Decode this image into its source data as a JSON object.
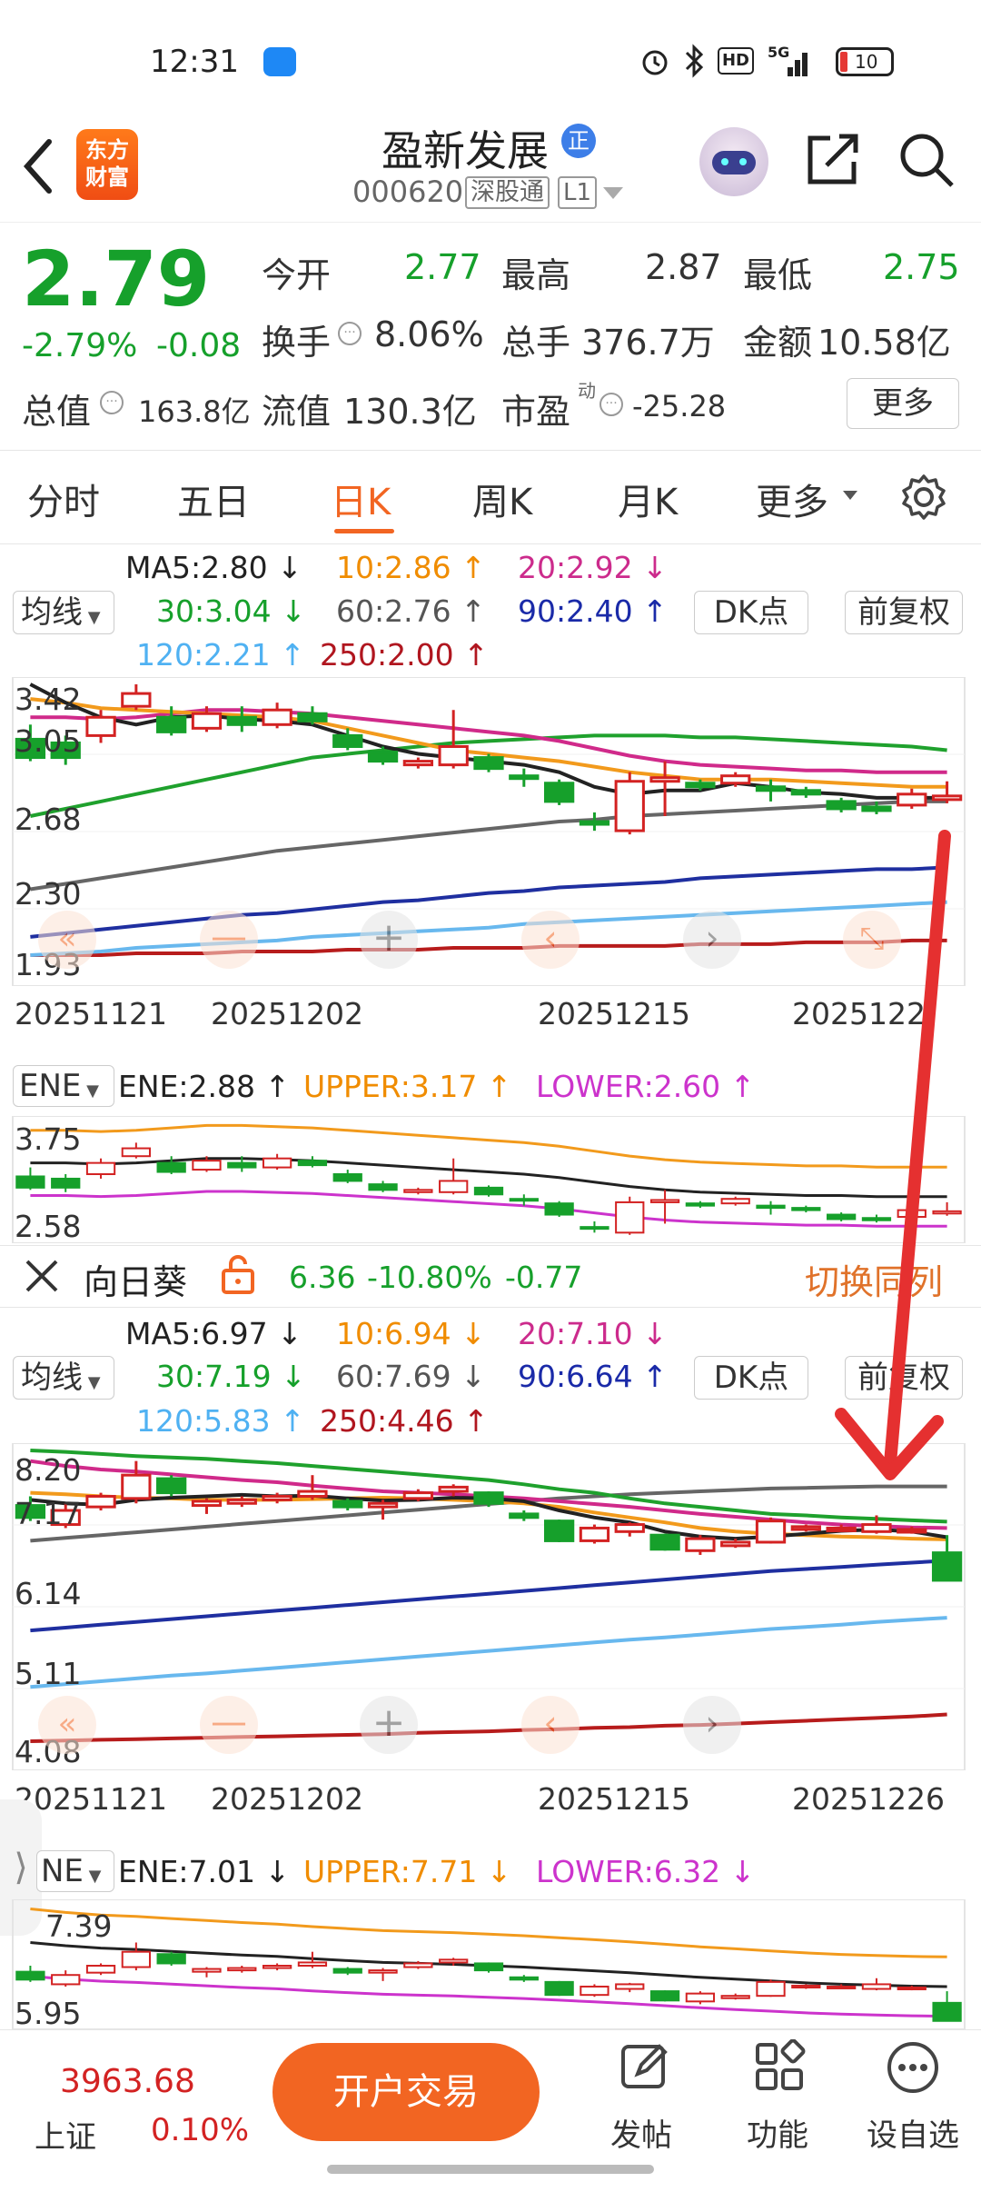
{
  "status_bar": {
    "time": "12:31",
    "battery": "10",
    "network": "5G"
  },
  "header": {
    "back_icon": "chevron-left-icon",
    "logo_text": "东方\n财富",
    "logo_line1": "东方",
    "logo_line2": "财富",
    "stock_name": "盈新发展",
    "badge": "正",
    "stock_code": "000620",
    "market_tag": "深股通",
    "level_tag": "L1"
  },
  "quote": {
    "price": "2.79",
    "change_pct": "-2.79%",
    "change": "-0.08",
    "open_label": "今开",
    "open": "2.77",
    "high_label": "最高",
    "high": "2.87",
    "low_label": "最低",
    "low": "2.75",
    "turnover_label": "换手",
    "turnover": "8.06%",
    "volume_label": "总手",
    "volume": "376.7万",
    "amount_label": "金额",
    "amount": "10.58亿",
    "mktcap_label": "总值",
    "mktcap": "163.8亿",
    "float_label": "流值",
    "float_cap": "130.3亿",
    "pe_label": "市盈",
    "pe_sup": "动",
    "pe": "-25.28",
    "more_label": "更多"
  },
  "tabs": [
    "分时",
    "五日",
    "日K",
    "周K",
    "月K",
    "更多"
  ],
  "active_tab": "日K",
  "chart1": {
    "indicator_select": "均线",
    "dk_label": "DK点",
    "adjust_label": "前复权",
    "ma": {
      "ma5": "MA5:2.80 ↓",
      "ma10": "10:2.86 ↑",
      "ma20": "20:2.92 ↓",
      "ma30": "30:3.04 ↓",
      "ma60": "60:2.76 ↑",
      "ma90": "90:2.40 ↑",
      "ma120": "120:2.21 ↑",
      "ma250": "250:2.00 ↑"
    },
    "y_ticks": [
      "3.42",
      "3.05",
      "2.68",
      "2.30",
      "1.93"
    ],
    "x_ticks": [
      "20251121",
      "20251202",
      "20251215",
      "2025122"
    ],
    "ene_select": "ENE",
    "ene": "ENE:2.88 ↑",
    "upper": "UPPER:3.17 ↑",
    "lower": "LOWER:2.60 ↑",
    "ene_ticks": [
      "3.75",
      "2.58"
    ]
  },
  "compare": {
    "close_icon": "close-icon",
    "name": "向日葵",
    "lock_icon": "lock-icon",
    "price": "6.36",
    "change_pct": "-10.80%",
    "change": "-0.77",
    "switch_label": "切换同列"
  },
  "chart2": {
    "indicator_select": "均线",
    "dk_label": "DK点",
    "adjust_label": "前复权",
    "ma": {
      "ma5": "MA5:6.97 ↓",
      "ma10": "10:6.94 ↓",
      "ma20": "20:7.10 ↓",
      "ma30": "30:7.19 ↓",
      "ma60": "60:7.69 ↓",
      "ma90": "90:6.64 ↑",
      "ma120": "120:5.83 ↑",
      "ma250": "250:4.46 ↑"
    },
    "y_ticks": [
      "8.20",
      "7.17",
      "6.14",
      "5.11",
      "4.08"
    ],
    "x_ticks": [
      "20251121",
      "20251202",
      "20251215",
      "20251226"
    ],
    "ene_select": "NE",
    "ene": "ENE:7.01 ↓",
    "upper": "UPPER:7.71 ↓",
    "lower": "LOWER:6.32 ↓",
    "ene_ticks": [
      "7.39",
      "5.95"
    ]
  },
  "bottom_bar": {
    "index_value": "3963.68",
    "index_name": "上证",
    "index_change": "0.10%",
    "trade_button": "开户交易",
    "post_label": "发帖",
    "func_label": "功能",
    "watch_label": "设自选"
  },
  "colors": {
    "up": "#d32222",
    "down": "#16a02b",
    "accent": "#f26522",
    "ma5": "#222222",
    "ma10": "#f29a1c",
    "ma20": "#d02a8a",
    "ma30": "#1fa12d",
    "ma60": "#666666",
    "ma90": "#1f2fa0",
    "ma120": "#68b8ee",
    "ma250": "#b71c1c"
  },
  "chart_data": [
    {
      "type": "candlestick",
      "name": "盈新发展 日K",
      "ylim": [
        1.93,
        3.42
      ],
      "x_ticks": [
        "20251121",
        "20251202",
        "20251215",
        "2025122"
      ],
      "candles": [
        {
          "o": 3.1,
          "c": 3.0,
          "h": 3.18,
          "l": 2.98
        },
        {
          "o": 3.08,
          "c": 3.0,
          "h": 3.12,
          "l": 2.96
        },
        {
          "o": 3.12,
          "c": 3.22,
          "h": 3.26,
          "l": 3.08
        },
        {
          "o": 3.28,
          "c": 3.35,
          "h": 3.4,
          "l": 3.26
        },
        {
          "o": 3.22,
          "c": 3.14,
          "h": 3.28,
          "l": 3.12
        },
        {
          "o": 3.16,
          "c": 3.24,
          "h": 3.28,
          "l": 3.14
        },
        {
          "o": 3.22,
          "c": 3.18,
          "h": 3.28,
          "l": 3.14
        },
        {
          "o": 3.18,
          "c": 3.26,
          "h": 3.3,
          "l": 3.16
        },
        {
          "o": 3.24,
          "c": 3.2,
          "h": 3.28,
          "l": 3.18
        },
        {
          "o": 3.12,
          "c": 3.06,
          "h": 3.16,
          "l": 3.04
        },
        {
          "o": 3.03,
          "c": 2.98,
          "h": 3.06,
          "l": 2.96
        },
        {
          "o": 2.96,
          "c": 2.98,
          "h": 3.0,
          "l": 2.94
        },
        {
          "o": 2.96,
          "c": 3.06,
          "h": 3.26,
          "l": 2.94
        },
        {
          "o": 3.0,
          "c": 2.94,
          "h": 3.02,
          "l": 2.92
        },
        {
          "o": 2.9,
          "c": 2.89,
          "h": 2.94,
          "l": 2.84
        },
        {
          "o": 2.86,
          "c": 2.76,
          "h": 2.88,
          "l": 2.74
        },
        {
          "o": 2.65,
          "c": 2.64,
          "h": 2.7,
          "l": 2.6
        },
        {
          "o": 2.6,
          "c": 2.87,
          "h": 2.92,
          "l": 2.58
        },
        {
          "o": 2.87,
          "c": 2.89,
          "h": 2.98,
          "l": 2.68
        },
        {
          "o": 2.86,
          "c": 2.84,
          "h": 2.88,
          "l": 2.82
        },
        {
          "o": 2.86,
          "c": 2.9,
          "h": 2.92,
          "l": 2.84
        },
        {
          "o": 2.84,
          "c": 2.82,
          "h": 2.88,
          "l": 2.76
        },
        {
          "o": 2.82,
          "c": 2.8,
          "h": 2.84,
          "l": 2.78
        },
        {
          "o": 2.76,
          "c": 2.72,
          "h": 2.78,
          "l": 2.7
        },
        {
          "o": 2.73,
          "c": 2.71,
          "h": 2.76,
          "l": 2.69
        },
        {
          "o": 2.74,
          "c": 2.8,
          "h": 2.83,
          "l": 2.72
        },
        {
          "o": 2.77,
          "c": 2.79,
          "h": 2.87,
          "l": 2.75
        }
      ],
      "series": [
        {
          "name": "MA5",
          "values": [
            3.4,
            3.3,
            3.22,
            3.18,
            3.22,
            3.23,
            3.21,
            3.2,
            3.18,
            3.12,
            3.06,
            3.02,
            3.0,
            2.98,
            2.96,
            2.92,
            2.84,
            2.8,
            2.82,
            2.82,
            2.86,
            2.84,
            2.81,
            2.8,
            2.78,
            2.78,
            2.78
          ]
        },
        {
          "name": "10",
          "values": [
            3.32,
            3.3,
            3.27,
            3.26,
            3.25,
            3.24,
            3.23,
            3.22,
            3.2,
            3.16,
            3.12,
            3.08,
            3.04,
            3.02,
            3.0,
            2.98,
            2.95,
            2.92,
            2.9,
            2.88,
            2.88,
            2.88,
            2.87,
            2.86,
            2.85,
            2.84,
            2.84
          ]
        },
        {
          "name": "20",
          "values": [
            3.22,
            3.22,
            3.21,
            3.22,
            3.24,
            3.26,
            3.26,
            3.25,
            3.24,
            3.22,
            3.2,
            3.18,
            3.16,
            3.14,
            3.12,
            3.09,
            3.05,
            3.01,
            2.98,
            2.96,
            2.95,
            2.94,
            2.93,
            2.93,
            2.92,
            2.92,
            2.92
          ]
        },
        {
          "name": "30",
          "values": [
            2.68,
            2.72,
            2.76,
            2.8,
            2.84,
            2.88,
            2.92,
            2.96,
            3.0,
            3.02,
            3.04,
            3.06,
            3.08,
            3.09,
            3.1,
            3.11,
            3.12,
            3.12,
            3.12,
            3.11,
            3.11,
            3.1,
            3.09,
            3.08,
            3.07,
            3.06,
            3.04
          ]
        },
        {
          "name": "60",
          "values": [
            2.28,
            2.31,
            2.34,
            2.37,
            2.4,
            2.43,
            2.46,
            2.49,
            2.51,
            2.53,
            2.55,
            2.57,
            2.59,
            2.61,
            2.63,
            2.65,
            2.66,
            2.68,
            2.69,
            2.7,
            2.71,
            2.72,
            2.73,
            2.74,
            2.75,
            2.76,
            2.76
          ]
        },
        {
          "name": "90",
          "values": [
            2.02,
            2.04,
            2.06,
            2.08,
            2.1,
            2.12,
            2.14,
            2.15,
            2.17,
            2.19,
            2.21,
            2.22,
            2.24,
            2.26,
            2.27,
            2.29,
            2.3,
            2.31,
            2.32,
            2.34,
            2.35,
            2.36,
            2.37,
            2.38,
            2.39,
            2.39,
            2.4
          ]
        },
        {
          "name": "120",
          "values": [
            1.92,
            1.93,
            1.94,
            1.96,
            1.97,
            1.98,
            1.99,
            2.0,
            2.02,
            2.03,
            2.04,
            2.05,
            2.06,
            2.07,
            2.09,
            2.1,
            2.11,
            2.12,
            2.13,
            2.14,
            2.15,
            2.16,
            2.17,
            2.18,
            2.19,
            2.2,
            2.21
          ]
        },
        {
          "name": "250",
          "values": [
            1.92,
            1.92,
            1.92,
            1.93,
            1.93,
            1.93,
            1.94,
            1.94,
            1.94,
            1.95,
            1.95,
            1.95,
            1.96,
            1.96,
            1.96,
            1.97,
            1.97,
            1.97,
            1.97,
            1.98,
            1.98,
            1.98,
            1.99,
            1.99,
            1.99,
            2.0,
            2.0
          ]
        }
      ]
    },
    {
      "type": "candlestick",
      "name": "向日葵 日K",
      "ylim": [
        4.08,
        8.2
      ],
      "x_ticks": [
        "20251121",
        "20251202",
        "20251215",
        "20251226"
      ],
      "candles": [
        {
          "o": 7.42,
          "c": 7.25,
          "h": 7.55,
          "l": 7.2
        },
        {
          "o": 7.15,
          "c": 7.35,
          "h": 7.45,
          "l": 7.1
        },
        {
          "o": 7.4,
          "c": 7.55,
          "h": 7.6,
          "l": 7.35
        },
        {
          "o": 7.52,
          "c": 7.85,
          "h": 8.05,
          "l": 7.45
        },
        {
          "o": 7.8,
          "c": 7.6,
          "h": 7.85,
          "l": 7.55
        },
        {
          "o": 7.42,
          "c": 7.48,
          "h": 7.52,
          "l": 7.3
        },
        {
          "o": 7.45,
          "c": 7.5,
          "h": 7.55,
          "l": 7.4
        },
        {
          "o": 7.5,
          "c": 7.55,
          "h": 7.6,
          "l": 7.45
        },
        {
          "o": 7.55,
          "c": 7.62,
          "h": 7.85,
          "l": 7.5
        },
        {
          "o": 7.48,
          "c": 7.4,
          "h": 7.52,
          "l": 7.35
        },
        {
          "o": 7.4,
          "c": 7.45,
          "h": 7.5,
          "l": 7.22
        },
        {
          "o": 7.52,
          "c": 7.6,
          "h": 7.65,
          "l": 7.48
        },
        {
          "o": 7.62,
          "c": 7.68,
          "h": 7.72,
          "l": 7.55
        },
        {
          "o": 7.6,
          "c": 7.45,
          "h": 7.62,
          "l": 7.4
        },
        {
          "o": 7.3,
          "c": 7.25,
          "h": 7.35,
          "l": 7.2
        },
        {
          "o": 7.2,
          "c": 6.92,
          "h": 7.22,
          "l": 6.9
        },
        {
          "o": 6.92,
          "c": 7.1,
          "h": 7.15,
          "l": 6.88
        },
        {
          "o": 7.05,
          "c": 7.15,
          "h": 7.18,
          "l": 6.98
        },
        {
          "o": 7.0,
          "c": 6.8,
          "h": 7.02,
          "l": 6.78
        },
        {
          "o": 6.78,
          "c": 6.95,
          "h": 7.0,
          "l": 6.72
        },
        {
          "o": 6.85,
          "c": 6.9,
          "h": 6.95,
          "l": 6.82
        },
        {
          "o": 6.9,
          "c": 7.2,
          "h": 7.25,
          "l": 6.88
        },
        {
          "o": 7.08,
          "c": 7.12,
          "h": 7.15,
          "l": 7.05
        },
        {
          "o": 7.08,
          "c": 7.1,
          "h": 7.15,
          "l": 7.05
        },
        {
          "o": 7.05,
          "c": 7.15,
          "h": 7.28,
          "l": 7.02
        },
        {
          "o": 7.05,
          "c": 7.08,
          "h": 7.12,
          "l": 7.02
        },
        {
          "o": 6.75,
          "c": 6.36,
          "h": 7.0,
          "l": 6.36
        }
      ],
      "series": [
        {
          "name": "MA5",
          "values": [
            7.5,
            7.45,
            7.43,
            7.5,
            7.53,
            7.55,
            7.57,
            7.55,
            7.56,
            7.52,
            7.49,
            7.5,
            7.53,
            7.52,
            7.48,
            7.35,
            7.25,
            7.18,
            7.05,
            6.98,
            6.95,
            6.98,
            7.02,
            7.06,
            7.08,
            7.05,
            6.97
          ]
        },
        {
          "name": "10",
          "values": [
            7.6,
            7.58,
            7.55,
            7.53,
            7.52,
            7.5,
            7.5,
            7.5,
            7.51,
            7.52,
            7.53,
            7.52,
            7.5,
            7.48,
            7.45,
            7.4,
            7.32,
            7.25,
            7.18,
            7.1,
            7.05,
            7.02,
            7.0,
            6.98,
            6.97,
            6.95,
            6.94
          ]
        },
        {
          "name": "20",
          "values": [
            8.05,
            7.98,
            7.93,
            7.9,
            7.86,
            7.82,
            7.78,
            7.75,
            7.7,
            7.66,
            7.62,
            7.6,
            7.58,
            7.55,
            7.52,
            7.48,
            7.44,
            7.4,
            7.35,
            7.3,
            7.26,
            7.22,
            7.18,
            7.15,
            7.13,
            7.11,
            7.1
          ]
        },
        {
          "name": "30",
          "values": [
            8.2,
            8.18,
            8.15,
            8.12,
            8.1,
            8.08,
            8.05,
            8.02,
            7.98,
            7.94,
            7.9,
            7.86,
            7.82,
            7.78,
            7.72,
            7.65,
            7.6,
            7.52,
            7.45,
            7.4,
            7.35,
            7.3,
            7.28,
            7.25,
            7.23,
            7.21,
            7.19
          ]
        },
        {
          "name": "60",
          "values": [
            6.92,
            6.96,
            7.0,
            7.04,
            7.08,
            7.12,
            7.16,
            7.2,
            7.24,
            7.28,
            7.32,
            7.36,
            7.4,
            7.44,
            7.48,
            7.52,
            7.55,
            7.58,
            7.6,
            7.62,
            7.64,
            7.66,
            7.67,
            7.68,
            7.69,
            7.69,
            7.69
          ]
        },
        {
          "name": "90",
          "values": [
            5.65,
            5.69,
            5.73,
            5.77,
            5.81,
            5.85,
            5.89,
            5.93,
            5.97,
            6.01,
            6.05,
            6.09,
            6.13,
            6.17,
            6.21,
            6.25,
            6.29,
            6.33,
            6.37,
            6.41,
            6.45,
            6.49,
            6.52,
            6.55,
            6.58,
            6.61,
            6.64
          ]
        },
        {
          "name": "120",
          "values": [
            4.85,
            4.89,
            4.93,
            4.97,
            5.01,
            5.04,
            5.08,
            5.12,
            5.16,
            5.2,
            5.24,
            5.28,
            5.32,
            5.36,
            5.4,
            5.44,
            5.48,
            5.52,
            5.55,
            5.59,
            5.63,
            5.67,
            5.7,
            5.73,
            5.77,
            5.8,
            5.83
          ]
        },
        {
          "name": "250",
          "values": [
            4.08,
            4.09,
            4.1,
            4.11,
            4.12,
            4.13,
            4.14,
            4.15,
            4.16,
            4.17,
            4.18,
            4.2,
            4.21,
            4.22,
            4.24,
            4.25,
            4.27,
            4.28,
            4.3,
            4.31,
            4.33,
            4.35,
            4.37,
            4.39,
            4.41,
            4.43,
            4.46
          ]
        }
      ]
    }
  ]
}
